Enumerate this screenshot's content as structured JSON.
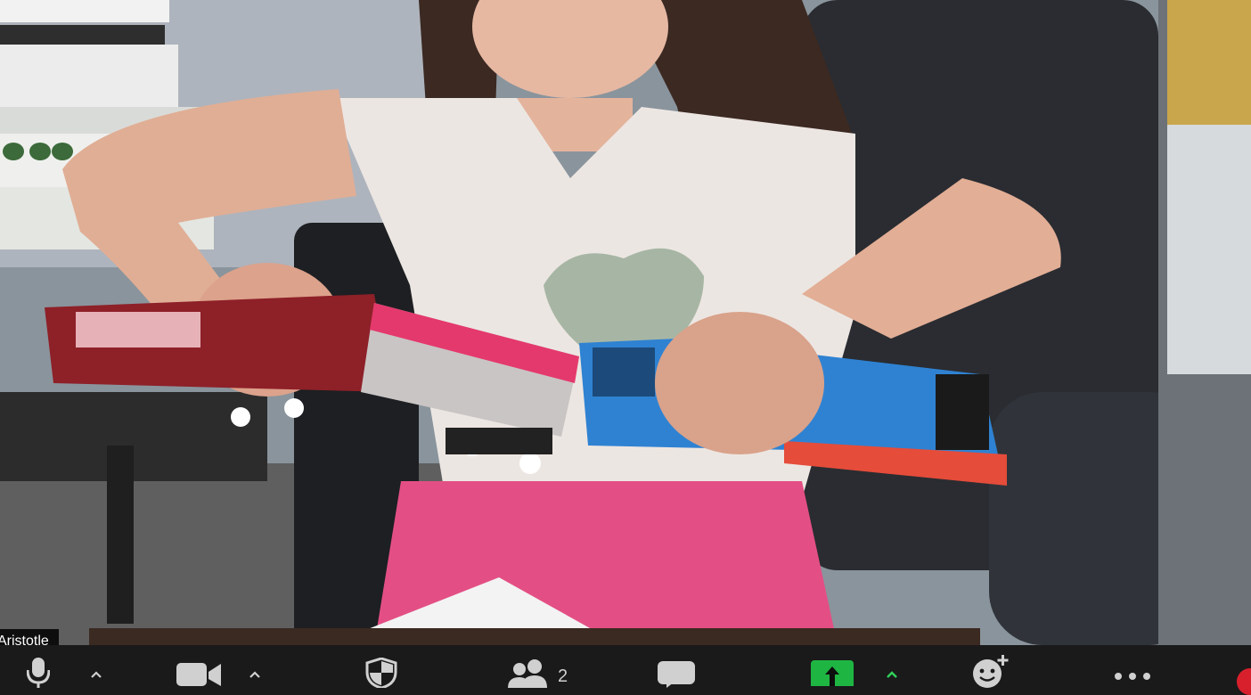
{
  "meeting": {
    "participant_name": "Aristotle",
    "participants_count": "2"
  },
  "toolbar": {
    "items": [
      {
        "id": "mute",
        "icon": "microphone-icon",
        "has_caret": true
      },
      {
        "id": "video",
        "icon": "video-camera-icon",
        "has_caret": true
      },
      {
        "id": "security",
        "icon": "shield-icon",
        "has_caret": false
      },
      {
        "id": "participants",
        "icon": "participants-icon",
        "has_caret": false
      },
      {
        "id": "chat",
        "icon": "chat-bubble-icon",
        "has_caret": false
      },
      {
        "id": "share-screen",
        "icon": "share-up-arrow-icon",
        "has_caret": true
      },
      {
        "id": "reactions",
        "icon": "add-reaction-icon",
        "has_caret": false
      },
      {
        "id": "more",
        "icon": "more-dots-icon",
        "has_caret": false
      },
      {
        "id": "end",
        "icon": "end-meeting-icon",
        "has_caret": false
      }
    ]
  },
  "colors": {
    "toolbar_bg": "#1a1a1a",
    "icon": "#d0d0d0",
    "share_green": "#1fb543",
    "share_caret_green": "#2fd15a",
    "end_red": "#d8202d"
  }
}
